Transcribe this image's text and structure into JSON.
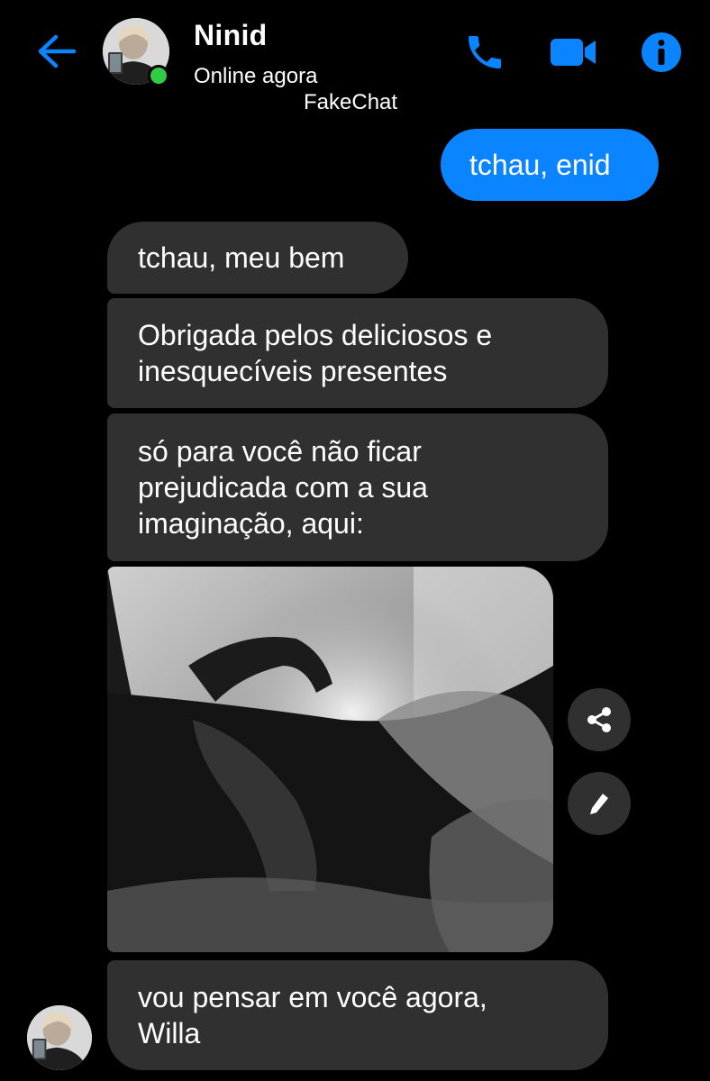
{
  "header": {
    "contact_name": "Ninid",
    "status": "Online agora",
    "watermark": "FakeChat",
    "back_icon": "arrow-left-icon",
    "call_icon": "phone-icon",
    "video_icon": "video-camera-icon",
    "info_icon": "info-icon",
    "accent_color": "#0a84ff",
    "online_color": "#31cc46"
  },
  "messages": [
    {
      "sender": "me",
      "text": "tchau, enid"
    },
    {
      "sender": "contact",
      "text": "tchau, meu bem"
    },
    {
      "sender": "contact",
      "text": "Obrigada pelos deliciosos e\ninesquecíveis presentes"
    },
    {
      "sender": "contact",
      "text": "só para você não ficar\nprejudicada com a sua\nimaginação, aqui:"
    },
    {
      "sender": "contact",
      "type": "photo"
    },
    {
      "sender": "contact",
      "text": "vou pensar em você agora,\nWilla"
    }
  ],
  "photo_actions": {
    "share_icon": "share-icon",
    "edit_icon": "pencil-icon"
  },
  "colors": {
    "background": "#000000",
    "incoming_bubble": "#303030",
    "outgoing_bubble": "#0a84ff"
  }
}
